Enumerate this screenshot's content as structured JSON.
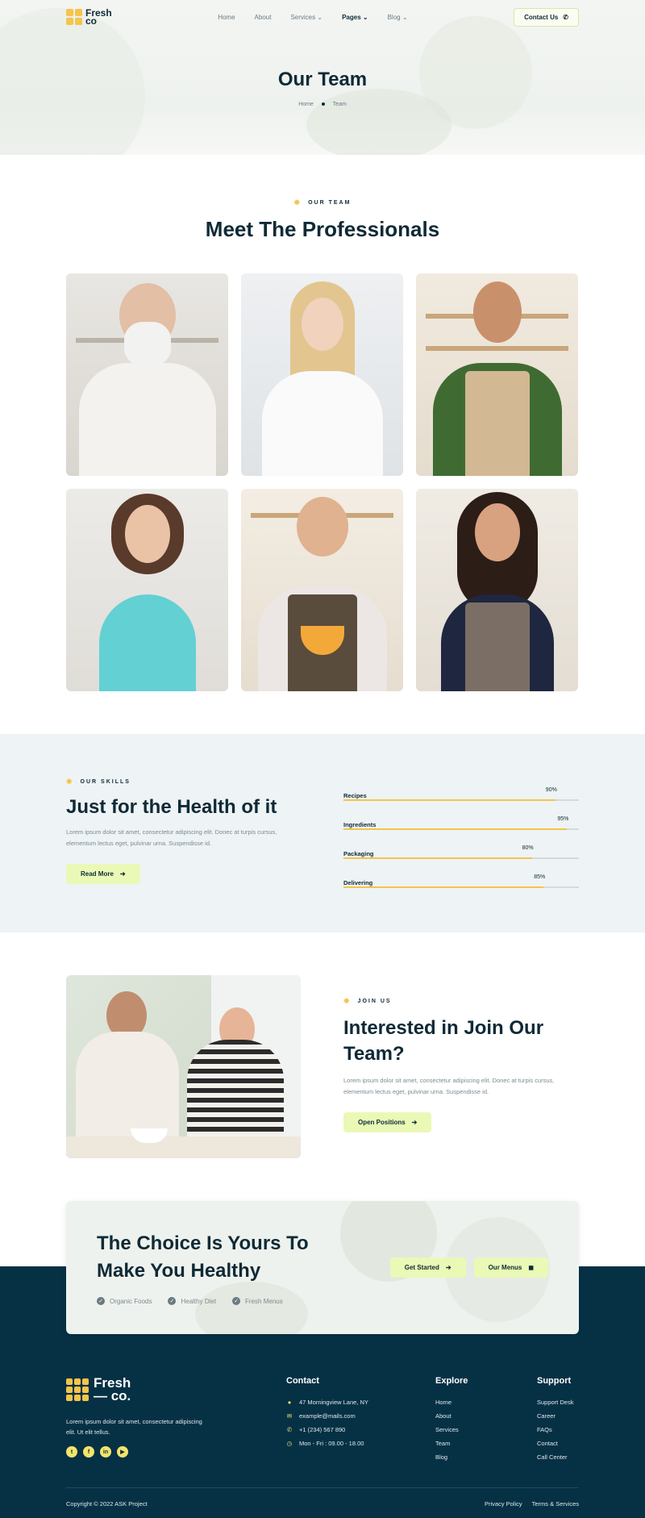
{
  "header": {
    "brand": {
      "line1": "Fresh",
      "line2": "co"
    },
    "nav": [
      {
        "label": "Home"
      },
      {
        "label": "About"
      },
      {
        "label": "Services"
      },
      {
        "label": "Pages"
      },
      {
        "label": "Blog"
      }
    ],
    "contact_label": "Contact Us"
  },
  "hero": {
    "title": "Our Team",
    "breadcrumb": [
      "Home",
      "Team"
    ]
  },
  "team": {
    "eyebrow": "OUR TEAM",
    "title": "Meet The Professionals"
  },
  "skills": {
    "eyebrow": "OUR SKILLS",
    "title": "Just for the Health of it",
    "text": "Lorem ipsum dolor sit amet, consectetur adipiscing elit. Donec at turpis cursus, elementum lectus eget, pulvinar urna. Suspendisse id.",
    "button": "Read More",
    "items": [
      {
        "label": "Recipes",
        "percent": 90,
        "text": "90%"
      },
      {
        "label": "Ingredients",
        "percent": 95,
        "text": "95%"
      },
      {
        "label": "Packaging",
        "percent": 80,
        "text": "80%"
      },
      {
        "label": "Delivering",
        "percent": 85,
        "text": "85%"
      }
    ]
  },
  "join": {
    "eyebrow": "JOIN US",
    "title": "Interested in Join Our Team?",
    "text": "Lorem ipsum dolor sit amet, consectetur adipiscing elit. Donec at turpis cursus, elementum lectus eget, pulvinar urna. Suspendisse id.",
    "button": "Open Positions"
  },
  "cta": {
    "title": "The Choice Is Yours To Make You Healthy",
    "checks": [
      "Organic Foods",
      "Healthy Diet",
      "Fresh Menus"
    ],
    "btn_start": "Get Started",
    "btn_menus": "Our Menus"
  },
  "footer": {
    "brand": {
      "line1": "Fresh",
      "line2": "— co."
    },
    "about": "Lorem ipsum dolor sit amet, consectetur adipiscing elit. Ut elit tellus.",
    "contact": {
      "title": "Contact",
      "address": "47 Morningview Lane, NY",
      "email": "example@mails.com",
      "phone": "+1 (234) 567 890",
      "hours": "Mon - Fri : 09.00 - 18.00"
    },
    "explore": {
      "title": "Explore",
      "items": [
        "Home",
        "About",
        "Services",
        "Team",
        "Blog"
      ]
    },
    "support": {
      "title": "Support",
      "items": [
        "Support Desk",
        "Career",
        "FAQs",
        "Contact",
        "Call Center"
      ]
    },
    "copyright": "Copyright © 2022 ASK Project",
    "links": [
      "Privacy Policy",
      "Terms & Services"
    ]
  },
  "colors": {
    "accent": "#f4c44c",
    "button_bg": "#eaf9b6",
    "footer_bg": "#063145",
    "dark_text": "#0f2a36"
  }
}
